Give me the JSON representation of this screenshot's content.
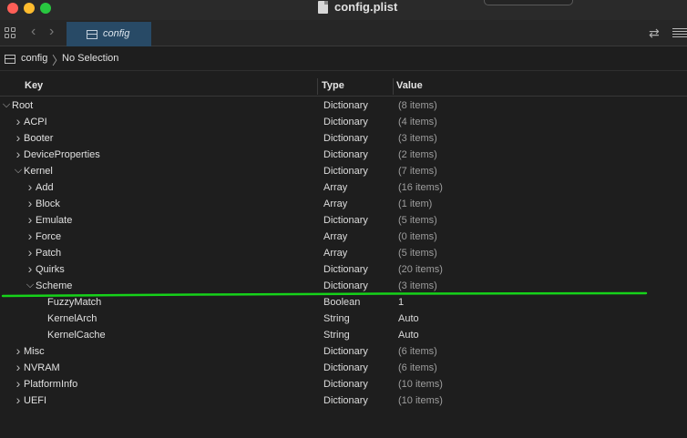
{
  "window": {
    "title": "config.plist"
  },
  "tab": {
    "label": "config"
  },
  "breadcrumb": {
    "root": "config",
    "separator": "〉",
    "leaf": "No Selection"
  },
  "columns": {
    "key": "Key",
    "type": "Type",
    "value": "Value"
  },
  "rows": [
    {
      "key": "Root",
      "type": "Dictionary",
      "value": "(8 items)",
      "depth": 0,
      "expander": "expanded"
    },
    {
      "key": "ACPI",
      "type": "Dictionary",
      "value": "(4 items)",
      "depth": 1,
      "expander": "collapsed"
    },
    {
      "key": "Booter",
      "type": "Dictionary",
      "value": "(3 items)",
      "depth": 1,
      "expander": "collapsed"
    },
    {
      "key": "DeviceProperties",
      "type": "Dictionary",
      "value": "(2 items)",
      "depth": 1,
      "expander": "collapsed"
    },
    {
      "key": "Kernel",
      "type": "Dictionary",
      "value": "(7 items)",
      "depth": 1,
      "expander": "expanded"
    },
    {
      "key": "Add",
      "type": "Array",
      "value": "(16 items)",
      "depth": 2,
      "expander": "collapsed"
    },
    {
      "key": "Block",
      "type": "Array",
      "value": "(1 item)",
      "depth": 2,
      "expander": "collapsed"
    },
    {
      "key": "Emulate",
      "type": "Dictionary",
      "value": "(5 items)",
      "depth": 2,
      "expander": "collapsed"
    },
    {
      "key": "Force",
      "type": "Array",
      "value": "(0 items)",
      "depth": 2,
      "expander": "collapsed"
    },
    {
      "key": "Patch",
      "type": "Array",
      "value": "(5 items)",
      "depth": 2,
      "expander": "collapsed"
    },
    {
      "key": "Quirks",
      "type": "Dictionary",
      "value": "(20 items)",
      "depth": 2,
      "expander": "collapsed"
    },
    {
      "key": "Scheme",
      "type": "Dictionary",
      "value": "(3 items)",
      "depth": 2,
      "expander": "expanded"
    },
    {
      "key": "FuzzyMatch",
      "type": "Boolean",
      "value": "1",
      "depth": 3,
      "expander": "none"
    },
    {
      "key": "KernelArch",
      "type": "String",
      "value": "Auto",
      "depth": 3,
      "expander": "none"
    },
    {
      "key": "KernelCache",
      "type": "String",
      "value": "Auto",
      "depth": 3,
      "expander": "none"
    },
    {
      "key": "Misc",
      "type": "Dictionary",
      "value": "(6 items)",
      "depth": 1,
      "expander": "collapsed"
    },
    {
      "key": "NVRAM",
      "type": "Dictionary",
      "value": "(6 items)",
      "depth": 1,
      "expander": "collapsed"
    },
    {
      "key": "PlatformInfo",
      "type": "Dictionary",
      "value": "(10 items)",
      "depth": 1,
      "expander": "collapsed"
    },
    {
      "key": "UEFI",
      "type": "Dictionary",
      "value": "(10 items)",
      "depth": 1,
      "expander": "collapsed"
    }
  ],
  "annotation": {
    "color": "#16d21a"
  },
  "colors": {
    "tab_active": "#284a66",
    "background": "#1e1e1e"
  }
}
